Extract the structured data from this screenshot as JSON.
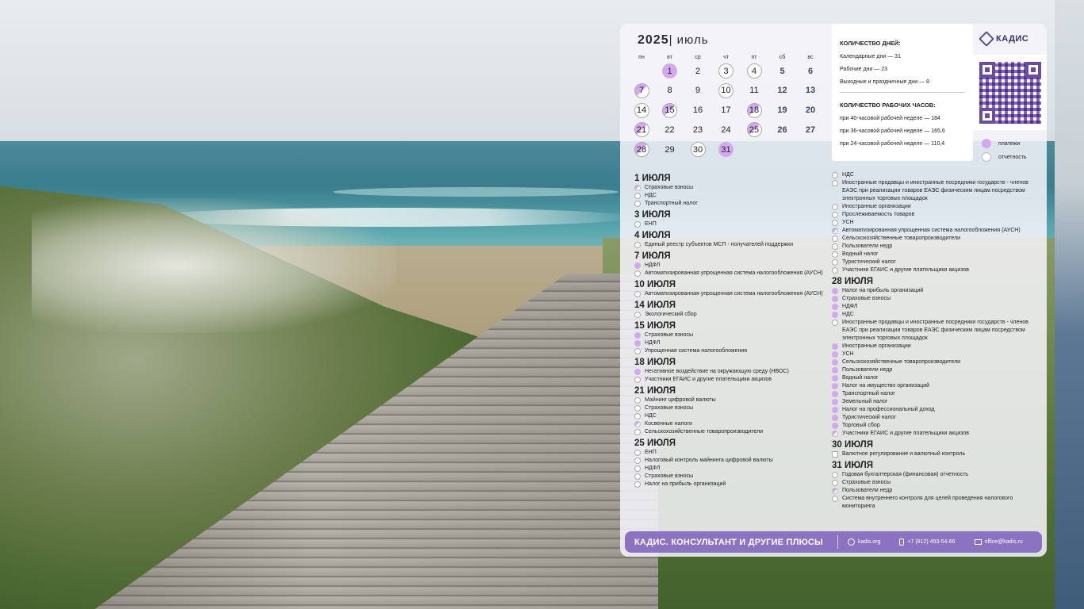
{
  "calendar": {
    "year": "2025",
    "month": "июль",
    "weekdays": [
      "пн",
      "вт",
      "ср",
      "чт",
      "пт",
      "сб",
      "вс"
    ],
    "days": [
      {
        "d": "1",
        "row": 0,
        "col": 1,
        "mark": "p"
      },
      {
        "d": "2",
        "row": 0,
        "col": 2,
        "mark": ""
      },
      {
        "d": "3",
        "row": 0,
        "col": 3,
        "mark": "o"
      },
      {
        "d": "4",
        "row": 0,
        "col": 4,
        "mark": "o"
      },
      {
        "d": "5",
        "row": 0,
        "col": 5,
        "mark": "we"
      },
      {
        "d": "6",
        "row": 0,
        "col": 6,
        "mark": "we"
      },
      {
        "d": "7",
        "row": 1,
        "col": 0,
        "mark": "h"
      },
      {
        "d": "8",
        "row": 1,
        "col": 1,
        "mark": ""
      },
      {
        "d": "9",
        "row": 1,
        "col": 2,
        "mark": ""
      },
      {
        "d": "10",
        "row": 1,
        "col": 3,
        "mark": "o"
      },
      {
        "d": "11",
        "row": 1,
        "col": 4,
        "mark": ""
      },
      {
        "d": "12",
        "row": 1,
        "col": 5,
        "mark": "we"
      },
      {
        "d": "13",
        "row": 1,
        "col": 6,
        "mark": "we"
      },
      {
        "d": "14",
        "row": 2,
        "col": 0,
        "mark": "o"
      },
      {
        "d": "15",
        "row": 2,
        "col": 1,
        "mark": "h"
      },
      {
        "d": "16",
        "row": 2,
        "col": 2,
        "mark": ""
      },
      {
        "d": "17",
        "row": 2,
        "col": 3,
        "mark": ""
      },
      {
        "d": "18",
        "row": 2,
        "col": 4,
        "mark": "h"
      },
      {
        "d": "19",
        "row": 2,
        "col": 5,
        "mark": "we"
      },
      {
        "d": "20",
        "row": 2,
        "col": 6,
        "mark": "we"
      },
      {
        "d": "21",
        "row": 3,
        "col": 0,
        "mark": "h"
      },
      {
        "d": "22",
        "row": 3,
        "col": 1,
        "mark": ""
      },
      {
        "d": "23",
        "row": 3,
        "col": 2,
        "mark": ""
      },
      {
        "d": "24",
        "row": 3,
        "col": 3,
        "mark": ""
      },
      {
        "d": "25",
        "row": 3,
        "col": 4,
        "mark": "h"
      },
      {
        "d": "26",
        "row": 3,
        "col": 5,
        "mark": "we"
      },
      {
        "d": "27",
        "row": 3,
        "col": 6,
        "mark": "we"
      },
      {
        "d": "28",
        "row": 4,
        "col": 0,
        "mark": "h"
      },
      {
        "d": "29",
        "row": 4,
        "col": 1,
        "mark": ""
      },
      {
        "d": "30",
        "row": 4,
        "col": 2,
        "mark": "o"
      },
      {
        "d": "31",
        "row": 4,
        "col": 3,
        "mark": "p"
      }
    ]
  },
  "stats": {
    "days_title": "КОЛИЧЕСТВО ДНЕЙ:",
    "calendar_days": "Календарные дни — 31",
    "work_days": "Рабочие дни — 23",
    "off_days": "Выходные и праздничные дни — 8",
    "hours_title": "КОЛИЧЕСТВО РАБОЧИХ ЧАСОВ:",
    "h40": "при 40-часовой рабочей неделе — 184",
    "h36": "при 36-часовой рабочей неделе — 165,6",
    "h24": "при 24-часовой рабочей неделе — 110,4"
  },
  "brand": {
    "name": "КАДИС"
  },
  "legend": {
    "payments": "платежи",
    "reports": "отчетность"
  },
  "left_column": [
    {
      "date": "1 ИЮЛЯ",
      "items": [
        {
          "t": "Страховые взносы",
          "m": "h"
        },
        {
          "t": "НДС",
          "m": "o"
        },
        {
          "t": "Транспортный налог",
          "m": "o"
        }
      ]
    },
    {
      "date": "3 ИЮЛЯ",
      "items": [
        {
          "t": "ЕНП",
          "m": "o"
        }
      ]
    },
    {
      "date": "4 ИЮЛЯ",
      "items": [
        {
          "t": "Единый реестр субъектов МСП - получателей поддержки",
          "m": "o"
        }
      ]
    },
    {
      "date": "7 ИЮЛЯ",
      "items": [
        {
          "t": "НДФЛ",
          "m": "p"
        },
        {
          "t": "Автоматизированная упрощенная система налогообложения (АУСН)",
          "m": "o"
        }
      ]
    },
    {
      "date": "10 ИЮЛЯ",
      "items": [
        {
          "t": "Автоматизированная упрощенная система налогообложения (АУСН)",
          "m": "o"
        }
      ]
    },
    {
      "date": "14 ИЮЛЯ",
      "items": [
        {
          "t": "Экологический сбор",
          "m": "o"
        }
      ]
    },
    {
      "date": "15 ИЮЛЯ",
      "items": [
        {
          "t": "Страховые взносы",
          "m": "p"
        },
        {
          "t": "НДФЛ",
          "m": "p"
        },
        {
          "t": "Упрощенная система налогообложения",
          "m": "o"
        }
      ]
    },
    {
      "date": "18 ИЮЛЯ",
      "items": [
        {
          "t": "Негативное воздействие на окружающую среду (НВОС)",
          "m": "p"
        },
        {
          "t": "Участники ЕГАИС и другие плательщики акцизов",
          "m": "o"
        }
      ]
    },
    {
      "date": "21 ИЮЛЯ",
      "items": [
        {
          "t": "Майнинг цифровой валюты",
          "m": "o"
        },
        {
          "t": "Страховые взносы",
          "m": "o"
        },
        {
          "t": "НДС",
          "m": "o"
        },
        {
          "t": "Косвенные налоги",
          "m": "h"
        },
        {
          "t": "Сельскохозяйственные товаропроизводители",
          "m": "o"
        }
      ]
    },
    {
      "date": "25 ИЮЛЯ",
      "items": [
        {
          "t": "ЕНП",
          "m": "o"
        },
        {
          "t": "Налоговый контроль майнинга цифровой валюты",
          "m": "o"
        },
        {
          "t": "НДФЛ",
          "m": "o"
        },
        {
          "t": "Страховые взносы",
          "m": "o"
        },
        {
          "t": "Налог на прибыль организаций",
          "m": "o"
        }
      ]
    }
  ],
  "right_column": [
    {
      "date": "",
      "items": [
        {
          "t": "НДС",
          "m": "o"
        },
        {
          "t": "Иностранные продавцы и иностранные посредники государств - членов ЕАЭС при реализации товаров ЕАЭС физическим лицам посредством электронных торговых площадок",
          "m": "o"
        },
        {
          "t": "Иностранные организации",
          "m": "o"
        },
        {
          "t": "Прослеживаемость товаров",
          "m": "o"
        },
        {
          "t": "УСН",
          "m": "o"
        },
        {
          "t": "Автоматизированная упрощенная система налогообложения (АУСН)",
          "m": "h"
        },
        {
          "t": "Сельскохозяйственные товаропроизводители",
          "m": "o"
        },
        {
          "t": "Пользователи недр",
          "m": "o"
        },
        {
          "t": "Водный налог",
          "m": "o"
        },
        {
          "t": "Туристический налог",
          "m": "o"
        },
        {
          "t": "Участники ЕГАИС и другие плательщики акцизов",
          "m": "o"
        }
      ]
    },
    {
      "date": "28 ИЮЛЯ",
      "items": [
        {
          "t": "Налог на прибыль организаций",
          "m": "p"
        },
        {
          "t": "Страховые взносы",
          "m": "p"
        },
        {
          "t": "НДФЛ",
          "m": "p"
        },
        {
          "t": "НДС",
          "m": "p"
        },
        {
          "t": "Иностранные продавцы и иностранные посредники государств - членов ЕАЭС при реализации товаров ЕАЭС физическим лицам посредством электронных торговых площадок",
          "m": "o"
        },
        {
          "t": "Иностранные организации",
          "m": "p"
        },
        {
          "t": "УСН",
          "m": "p"
        },
        {
          "t": "Сельскохозяйственные товаропроизводители",
          "m": "p"
        },
        {
          "t": "Пользователи недр",
          "m": "p"
        },
        {
          "t": "Водный налог",
          "m": "p"
        },
        {
          "t": "Налог на имущество организаций",
          "m": "p"
        },
        {
          "t": "Транспортный налог",
          "m": "p"
        },
        {
          "t": "Земельный налог",
          "m": "p"
        },
        {
          "t": "Налог на профессиональный доход",
          "m": "p"
        },
        {
          "t": "Туристический налог",
          "m": "p"
        },
        {
          "t": "Торговый сбор",
          "m": "p"
        },
        {
          "t": "Участники ЕГАИС и другие плательщики акцизов",
          "m": "h"
        }
      ]
    },
    {
      "date": "30 ИЮЛЯ",
      "items": [
        {
          "t": "Валютное регулирование и валютный контроль",
          "m": "sq"
        }
      ]
    },
    {
      "date": "31 ИЮЛЯ",
      "items": [
        {
          "t": "Годовая бухгалтерская (финансовая) отчетность",
          "m": "o"
        },
        {
          "t": "Страховые взносы",
          "m": "o"
        },
        {
          "t": "Пользователи недр",
          "m": "h"
        },
        {
          "t": "Система внутреннего контроля для целей проведения налогового мониторинга",
          "m": "o"
        }
      ]
    }
  ],
  "footer": {
    "title": "КАДИС. КОНСУЛЬТАНТ И ДРУГИЕ ПЛЮСЫ",
    "site": "kadis.org",
    "phone": "+7 (812) 493-54-66",
    "email": "office@kadis.ru"
  },
  "colors": {
    "payments": "#d4a8ee",
    "footer": "#8b73c2",
    "brand": "#3a2f6e"
  }
}
